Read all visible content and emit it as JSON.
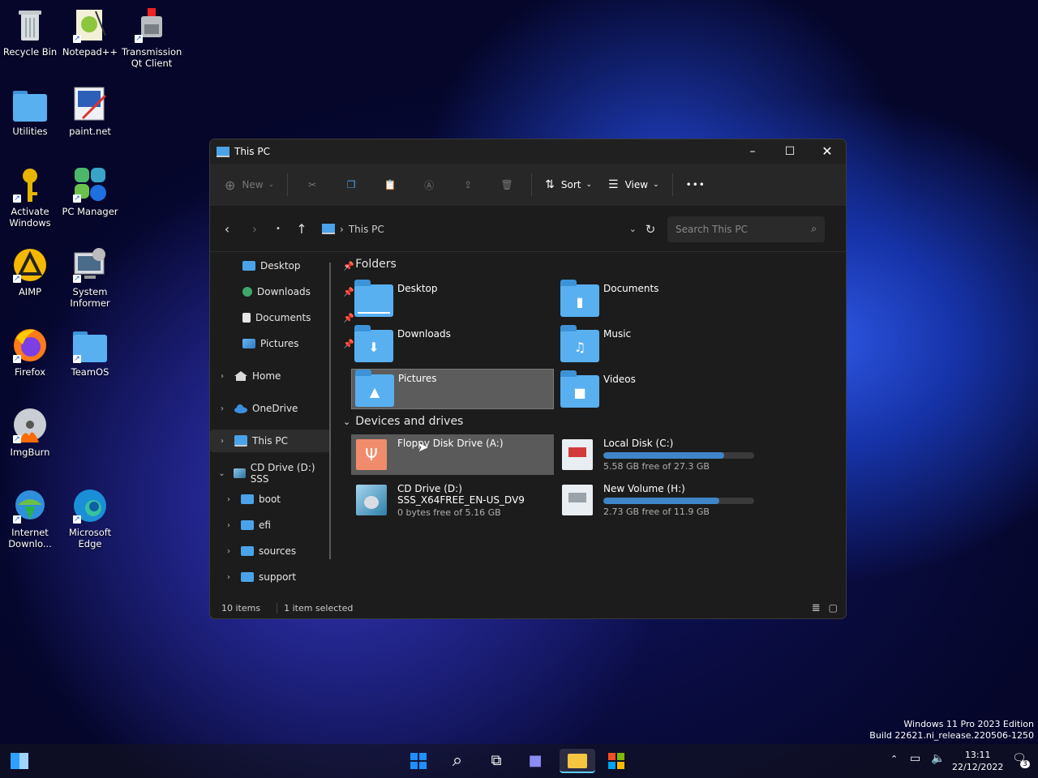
{
  "desktop": {
    "icons": [
      {
        "label": "Recycle Bin",
        "icon": "recycle-bin-icon"
      },
      {
        "label": "Notepad++",
        "icon": "notepad-plus-plus-icon"
      },
      {
        "label": "Transmission Qt Client",
        "icon": "transmission-icon"
      },
      {
        "label": "Utilities",
        "icon": "folder-icon"
      },
      {
        "label": "paint.net",
        "icon": "paint-net-icon"
      },
      {
        "label": "Activate Windows",
        "icon": "key-icon"
      },
      {
        "label": "PC Manager",
        "icon": "pc-manager-icon"
      },
      {
        "label": "AIMP",
        "icon": "aimp-icon"
      },
      {
        "label": "System Informer",
        "icon": "system-informer-icon"
      },
      {
        "label": "Firefox",
        "icon": "firefox-icon"
      },
      {
        "label": "TeamOS",
        "icon": "folder-icon"
      },
      {
        "label": "ImgBurn",
        "icon": "imgburn-icon"
      },
      {
        "label": "Internet Downlo...",
        "icon": "internet-download-manager-icon"
      },
      {
        "label": "Microsoft Edge",
        "icon": "edge-icon"
      }
    ]
  },
  "window": {
    "title": "This PC",
    "toolbar": {
      "new_label": "New",
      "sort_label": "Sort",
      "view_label": "View",
      "more_label": "•••"
    },
    "address": {
      "path_label": "This PC",
      "separator": "›",
      "search_placeholder": "Search This PC"
    },
    "sidebar": {
      "quick": [
        {
          "label": "Desktop",
          "pin": "📌"
        },
        {
          "label": "Downloads",
          "pin": "📌"
        },
        {
          "label": "Documents",
          "pin": "📌"
        },
        {
          "label": "Pictures",
          "pin": "📌"
        }
      ],
      "home": "Home",
      "onedrive": "OneDrive",
      "thispc": "This PC",
      "cddrive": "CD Drive (D:) SSS",
      "cd_children": [
        "boot",
        "efi",
        "sources",
        "support"
      ]
    },
    "folders_header": "Folders",
    "folders": [
      {
        "name": "Desktop"
      },
      {
        "name": "Documents"
      },
      {
        "name": "Downloads"
      },
      {
        "name": "Music"
      },
      {
        "name": "Pictures"
      },
      {
        "name": "Videos"
      }
    ],
    "devices_header": "Devices and drives",
    "drives": {
      "floppy": {
        "name": "Floppy Disk Drive (A:)"
      },
      "local_c": {
        "name": "Local Disk (C:)",
        "free": "5.58 GB free of 27.3 GB",
        "used_fraction": 0.8
      },
      "cd_d": {
        "name": "CD Drive (D:)",
        "label": "SSS_X64FREE_EN-US_DV9",
        "free": "0 bytes free of 5.16 GB"
      },
      "new_h": {
        "name": "New Volume (H:)",
        "free": "2.73 GB free of 11.9 GB",
        "used_fraction": 0.77
      }
    },
    "status": {
      "items": "10 items",
      "selected": "1 item selected"
    }
  },
  "watermark": {
    "line1": "Windows 11 Pro 2023 Edition",
    "line2": "Build 22621.ni_release.220506-1250"
  },
  "taskbar": {
    "time": "13:11",
    "date": "22/12/2022",
    "notification_count": "3"
  }
}
